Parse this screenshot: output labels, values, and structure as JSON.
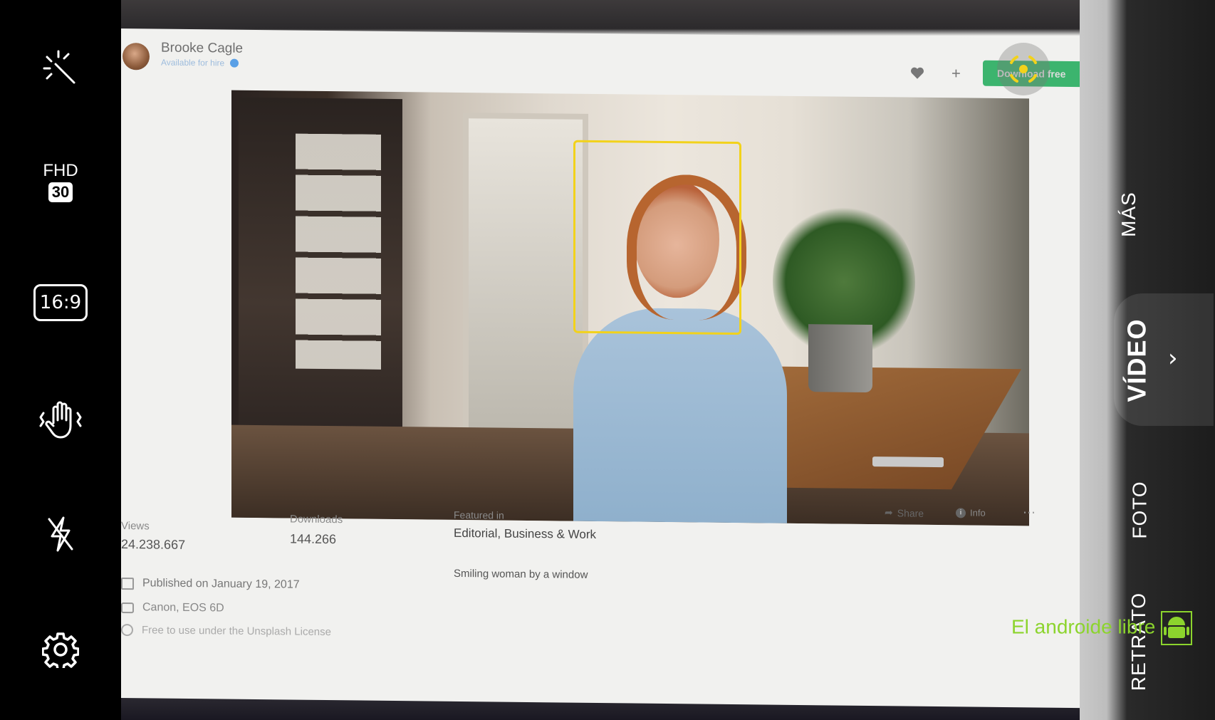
{
  "camera": {
    "video_resolution": "FHD",
    "frame_rate": "30",
    "aspect_ratio": "16:9",
    "modes": [
      "MÁS",
      "VÍDEO",
      "FOTO",
      "RETRATO"
    ],
    "active_mode": "VÍDEO",
    "icons": [
      "auto-enhance-icon",
      "gesture-hand-icon",
      "flash-off-icon",
      "settings-gear-icon",
      "focus-target-icon",
      "chevron-right-icon"
    ]
  },
  "web_page": {
    "author": {
      "name": "Brooke Cagle",
      "status": "Available for hire"
    },
    "buttons": {
      "download": "Download free",
      "share": "Share",
      "info": "Info"
    },
    "stats": {
      "views_label": "Views",
      "views_value": "24.238.667",
      "downloads_label": "Downloads",
      "downloads_value": "144.266",
      "featured_label": "Featured in",
      "featured_value": "Editorial, Business & Work"
    },
    "meta": {
      "published": "Published on January 19, 2017",
      "camera": "Canon, EOS 6D",
      "license": "Free to use under the Unsplash License",
      "description": "Smiling woman by a window"
    },
    "colors": {
      "download_green": "#3cb46e",
      "focus_yellow": "#f2d21b"
    }
  },
  "watermark": "El androide libre"
}
